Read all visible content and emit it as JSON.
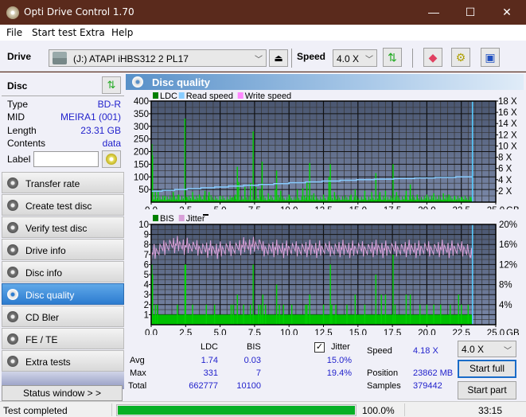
{
  "window": {
    "title": "Opti Drive Control 1.70",
    "minimize": "—",
    "maximize": "☐",
    "close": "✕"
  },
  "menu": [
    "File",
    "Start test",
    "Extra",
    "Help"
  ],
  "toolbar": {
    "drive_label": "Drive",
    "drive_value": "(J:)  ATAPI iHBS312   2 PL17",
    "speed_label": "Speed",
    "speed_value": "4.0 X",
    "icons": [
      "refresh-icon",
      "eraser-icon",
      "settings-icon",
      "save-icon"
    ]
  },
  "disc": {
    "header": "Disc",
    "fields": [
      {
        "key": "Type",
        "value": "BD-R"
      },
      {
        "key": "MID",
        "value": "MEIRA1 (001)"
      },
      {
        "key": "Length",
        "value": "23.31 GB"
      },
      {
        "key": "Contents",
        "value": "data"
      }
    ],
    "label_key": "Label",
    "label_value": ""
  },
  "nav": [
    {
      "label": "Transfer rate",
      "active": false
    },
    {
      "label": "Create test disc",
      "active": false
    },
    {
      "label": "Verify test disc",
      "active": false
    },
    {
      "label": "Drive info",
      "active": false
    },
    {
      "label": "Disc info",
      "active": false
    },
    {
      "label": "Disc quality",
      "active": true
    },
    {
      "label": "CD Bler",
      "active": false
    },
    {
      "label": "FE / TE",
      "active": false
    },
    {
      "label": "Extra tests",
      "active": false
    }
  ],
  "status_window_button": "Status window > >",
  "panel": {
    "title": "Disc quality"
  },
  "chart_data": [
    {
      "type": "bar",
      "title": "LDC / Read speed",
      "legend": [
        {
          "name": "LDC",
          "color": "#008000"
        },
        {
          "name": "Read speed",
          "color": "#88ccff"
        },
        {
          "name": "Write speed",
          "color": "#ff88ff"
        }
      ],
      "x_ticks": [
        "0.0",
        "2.5",
        "5.0",
        "7.5",
        "10.0",
        "12.5",
        "15.0",
        "17.5",
        "20.0",
        "22.5",
        "25.0 GB"
      ],
      "xlim": [
        0,
        25
      ],
      "y_left_ticks": [
        "50",
        "100",
        "150",
        "200",
        "250",
        "300",
        "350",
        "400"
      ],
      "ylim_left": [
        0,
        400
      ],
      "y_right_ticks": [
        "2 X",
        "4 X",
        "6 X",
        "8 X",
        "10 X",
        "12 X",
        "14 X",
        "16 X",
        "18 X"
      ],
      "ylim_right": [
        0,
        18
      ],
      "end_marker_gb": 23.31,
      "ldc_spikes": [
        [
          0.05,
          230
        ],
        [
          0.1,
          185
        ],
        [
          0.3,
          40
        ],
        [
          0.5,
          45
        ],
        [
          1.0,
          25
        ],
        [
          1.6,
          40
        ],
        [
          2.0,
          30
        ],
        [
          2.45,
          331
        ],
        [
          2.6,
          20
        ],
        [
          3.0,
          40
        ],
        [
          3.5,
          30
        ],
        [
          3.9,
          45
        ],
        [
          4.2,
          40
        ],
        [
          5.0,
          25
        ],
        [
          5.9,
          20
        ],
        [
          6.1,
          30
        ],
        [
          6.25,
          140
        ],
        [
          6.35,
          80
        ],
        [
          6.8,
          60
        ],
        [
          7.2,
          75
        ],
        [
          7.4,
          280
        ],
        [
          7.6,
          60
        ],
        [
          7.9,
          50
        ],
        [
          8.05,
          160
        ],
        [
          8.5,
          35
        ],
        [
          9.0,
          50
        ],
        [
          9.1,
          125
        ],
        [
          9.4,
          45
        ],
        [
          10.0,
          30
        ],
        [
          10.6,
          50
        ],
        [
          11.0,
          55
        ],
        [
          11.3,
          80
        ],
        [
          11.5,
          155
        ],
        [
          11.8,
          35
        ],
        [
          12.5,
          30
        ],
        [
          12.9,
          100
        ],
        [
          13.0,
          150
        ],
        [
          13.3,
          40
        ],
        [
          14.5,
          30
        ],
        [
          14.8,
          50
        ],
        [
          15.5,
          45
        ],
        [
          16.0,
          40
        ],
        [
          16.3,
          115
        ],
        [
          16.6,
          40
        ],
        [
          17.0,
          45
        ],
        [
          17.55,
          150
        ],
        [
          17.8,
          40
        ],
        [
          18.5,
          45
        ],
        [
          18.8,
          70
        ],
        [
          19.3,
          30
        ],
        [
          20.0,
          30
        ],
        [
          20.5,
          35
        ],
        [
          21.2,
          35
        ],
        [
          21.6,
          30
        ],
        [
          22.0,
          25
        ],
        [
          22.5,
          20
        ],
        [
          23.2,
          20
        ]
      ],
      "ldc_baseline": 8,
      "read_speed_steps": [
        [
          0.0,
          1.95
        ],
        [
          0.8,
          2.1
        ],
        [
          1.7,
          2.25
        ],
        [
          2.6,
          2.4
        ],
        [
          3.6,
          2.55
        ],
        [
          4.6,
          2.7
        ],
        [
          5.6,
          2.85
        ],
        [
          6.7,
          3.0
        ],
        [
          7.8,
          3.15
        ],
        [
          8.9,
          3.3
        ],
        [
          10.0,
          3.45
        ],
        [
          11.2,
          3.6
        ],
        [
          12.4,
          3.75
        ],
        [
          13.7,
          3.9
        ],
        [
          14.9,
          4.0
        ],
        [
          16.2,
          4.1
        ],
        [
          17.6,
          4.2
        ],
        [
          19.1,
          4.3
        ],
        [
          20.6,
          4.4
        ],
        [
          22.1,
          4.5
        ],
        [
          23.31,
          4.55
        ]
      ]
    },
    {
      "type": "bar",
      "title": "BIS / Jitter",
      "legend": [
        {
          "name": "BIS",
          "color": "#008000"
        },
        {
          "name": "Jitter",
          "color": "#d8a0d8"
        }
      ],
      "x_ticks": [
        "0.0",
        "2.5",
        "5.0",
        "7.5",
        "10.0",
        "12.5",
        "15.0",
        "17.5",
        "20.0",
        "22.5",
        "25.0 GB"
      ],
      "xlim": [
        0,
        25
      ],
      "y_left_ticks": [
        "1",
        "2",
        "3",
        "4",
        "5",
        "6",
        "7",
        "8",
        "9",
        "10"
      ],
      "ylim_left": [
        0,
        10
      ],
      "y_right_ticks": [
        "4%",
        "8%",
        "12%",
        "16%",
        "20%"
      ],
      "ylim_right": [
        0,
        20
      ],
      "end_marker_gb": 23.31,
      "bis_baseline": 1,
      "bis_spikes": [
        [
          0.05,
          6
        ],
        [
          0.1,
          5
        ],
        [
          0.3,
          2
        ],
        [
          0.45,
          2
        ],
        [
          1.9,
          2
        ],
        [
          2.45,
          6
        ],
        [
          2.5,
          6
        ],
        [
          3.0,
          2
        ],
        [
          4.0,
          2
        ],
        [
          4.6,
          2
        ],
        [
          5.8,
          2
        ],
        [
          5.95,
          2
        ],
        [
          6.25,
          3
        ],
        [
          6.7,
          2
        ],
        [
          7.2,
          2
        ],
        [
          7.4,
          6
        ],
        [
          7.8,
          2
        ],
        [
          7.95,
          2
        ],
        [
          8.1,
          3
        ],
        [
          8.3,
          2
        ],
        [
          9.1,
          4
        ],
        [
          9.3,
          2
        ],
        [
          9.6,
          2
        ],
        [
          10.2,
          2
        ],
        [
          11.2,
          2
        ],
        [
          11.3,
          2
        ],
        [
          11.5,
          3
        ],
        [
          12.5,
          2
        ],
        [
          13.0,
          6
        ],
        [
          13.1,
          2
        ],
        [
          13.4,
          2
        ],
        [
          14.2,
          2
        ],
        [
          14.8,
          3
        ],
        [
          15.5,
          2
        ],
        [
          16.3,
          5
        ],
        [
          16.7,
          3
        ],
        [
          17.0,
          3
        ],
        [
          17.55,
          7
        ],
        [
          17.7,
          2
        ],
        [
          18.5,
          3
        ],
        [
          18.8,
          3
        ],
        [
          19.5,
          2
        ],
        [
          20.0,
          2
        ],
        [
          20.5,
          2
        ],
        [
          21.0,
          2
        ],
        [
          21.7,
          2
        ],
        [
          22.3,
          3
        ],
        [
          22.5,
          2
        ],
        [
          23.0,
          2
        ]
      ],
      "jitter_mean_pct": 15.0,
      "jitter_max_pct": 19.4,
      "jitter_start_pct": 14.2,
      "jitter_end_pct": 12.5
    }
  ],
  "stats": {
    "col_ldc": "LDC",
    "col_bis": "BIS",
    "jitter_label": "Jitter",
    "jitter_checked": true,
    "rows": [
      {
        "label": "Avg",
        "ldc": "1.74",
        "bis": "0.03",
        "jitter": "15.0%"
      },
      {
        "label": "Max",
        "ldc": "331",
        "bis": "7",
        "jitter": "19.4%"
      },
      {
        "label": "Total",
        "ldc": "662777",
        "bis": "10100",
        "jitter": ""
      }
    ],
    "speed_label": "Speed",
    "speed_value": "4.18 X",
    "position_label": "Position",
    "position_value": "23862 MB",
    "samples_label": "Samples",
    "samples_value": "379442",
    "speed_select": "4.0 X",
    "start_full": "Start full",
    "start_part": "Start part"
  },
  "statusbar": {
    "message": "Test completed",
    "progress_pct": 100.0,
    "progress_text": "100.0%",
    "elapsed": "33:15"
  }
}
